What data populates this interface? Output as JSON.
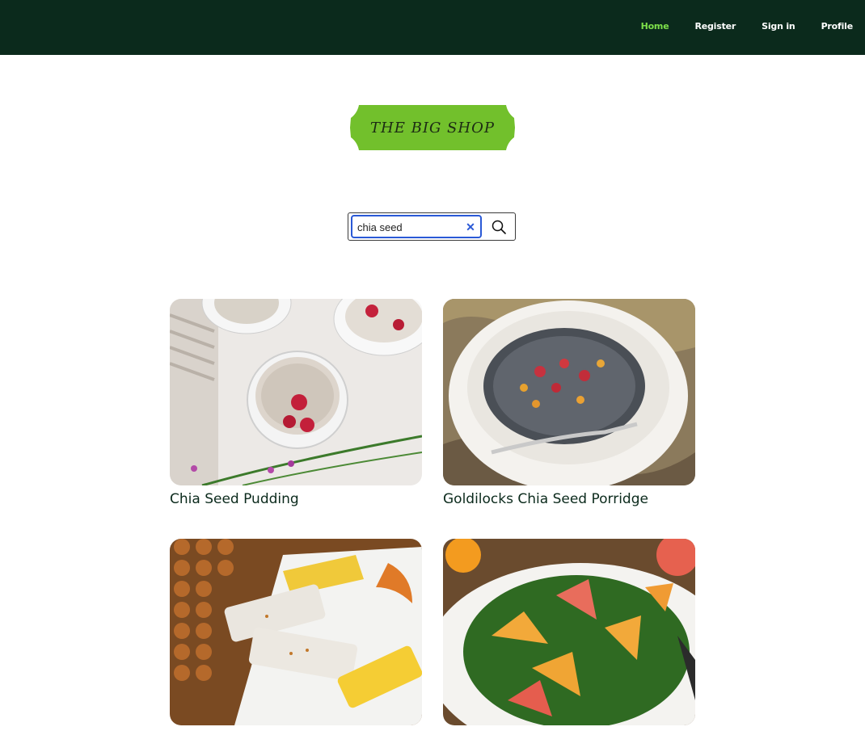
{
  "nav": {
    "items": [
      {
        "label": "Home",
        "active": true
      },
      {
        "label": "Register",
        "active": false
      },
      {
        "label": "Sign in",
        "active": false
      },
      {
        "label": "Profile",
        "active": false
      }
    ]
  },
  "logo": {
    "text": "THE BIG SHOP"
  },
  "search": {
    "value": "chia seed",
    "clear_icon": "close-icon",
    "button_icon": "search-icon"
  },
  "recipes": [
    {
      "title": "Chia Seed Pudding"
    },
    {
      "title": "Goldilocks Chia Seed Porridge"
    },
    {
      "title": ""
    },
    {
      "title": ""
    }
  ],
  "colors": {
    "topbar": "#0b2a1c",
    "nav_active": "#7ee04a",
    "logo_green": "#72c02c",
    "search_focus": "#2a59d6"
  }
}
